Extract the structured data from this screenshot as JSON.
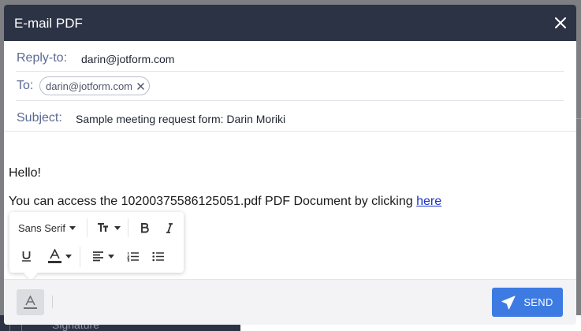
{
  "modal": {
    "title": "E-mail PDF"
  },
  "fields": {
    "reply_to_label": "Reply-to:",
    "reply_to_value": "darin@jotform.com",
    "to_label": "To:",
    "to_chip": "darin@jotform.com",
    "subject_label": "Subject:",
    "subject_value": "Sample meeting request form: Darin Moriki"
  },
  "message": {
    "greeting": "Hello!",
    "body_prefix": "You can access the 10200375586125051.pdf PDF Document by clicking",
    "link_text": "here"
  },
  "toolbar": {
    "font_family": "Sans Serif",
    "icons": [
      "font-size-icon",
      "bold-icon",
      "italic-icon",
      "underline-icon",
      "text-color-icon",
      "align-icon",
      "ordered-list-icon",
      "bullet-list-icon"
    ]
  },
  "footer": {
    "send_label": "SEND"
  },
  "background": {
    "partial_label": "Signature"
  },
  "colors": {
    "header_bg": "#2c3345",
    "label_color": "#5b6a93",
    "send_button": "#3d7be3",
    "link": "#1a33c9"
  }
}
